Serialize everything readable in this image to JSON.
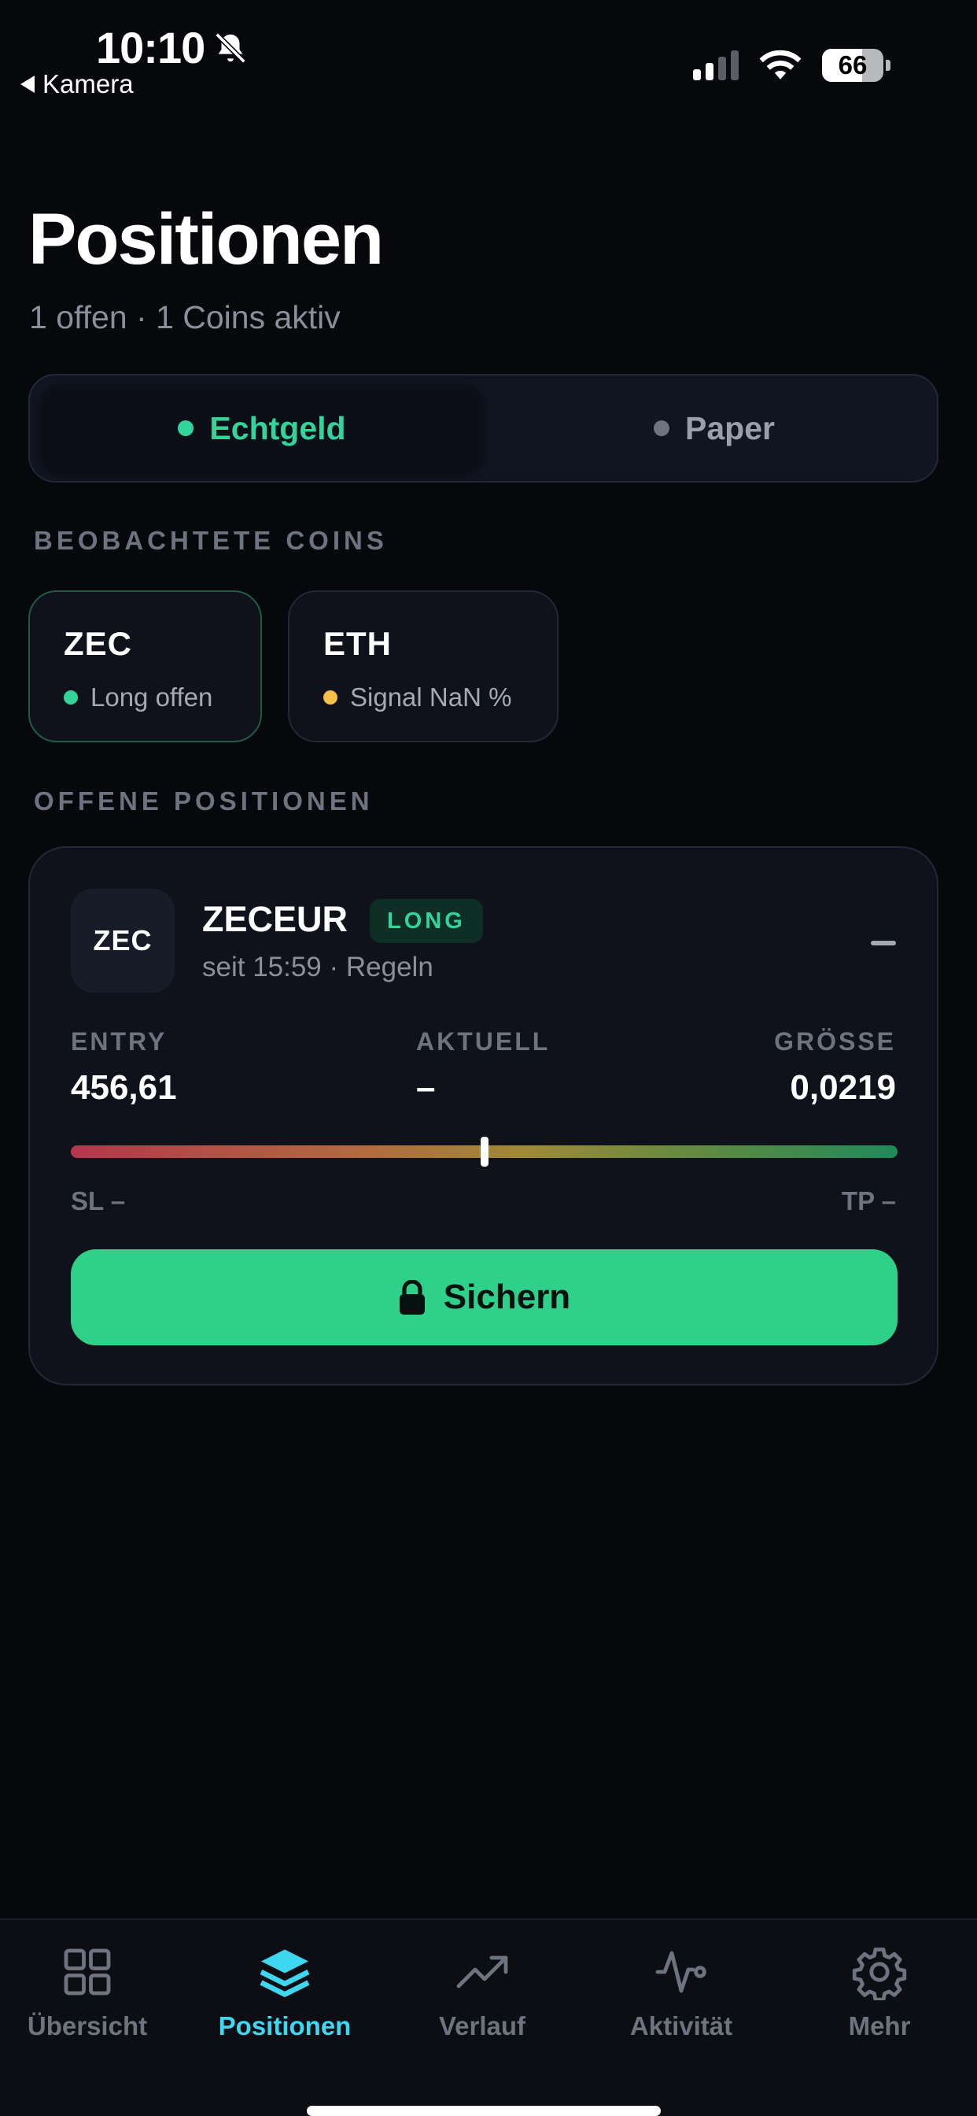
{
  "status_bar": {
    "time": "10:10",
    "back_label": "Kamera",
    "battery": "66"
  },
  "header": {
    "title": "Positionen",
    "subtitle": "1 offen · 1 Coins aktiv"
  },
  "mode_toggle": {
    "options": [
      {
        "label": "Echtgeld",
        "active": true,
        "dot_color": "#34d399"
      },
      {
        "label": "Paper",
        "active": false,
        "dot_color": "#6e7380"
      }
    ]
  },
  "watched_coins": {
    "section_label": "BEOBACHTETE COINS",
    "coins": [
      {
        "symbol": "ZEC",
        "status": "Long offen",
        "dot_color": "#34d399",
        "active": true
      },
      {
        "symbol": "ETH",
        "status": "Signal NaN %",
        "dot_color": "#f5c04a",
        "active": false
      }
    ]
  },
  "open_positions": {
    "section_label": "OFFENE POSITIONEN",
    "positions": [
      {
        "avatar": "ZEC",
        "symbol": "ZECEUR",
        "badge": "LONG",
        "meta": "seit 15:59 · Regeln",
        "stats": {
          "entry_label": "ENTRY",
          "entry_value": "456,61",
          "current_label": "AKTUELL",
          "current_value": "–",
          "size_label": "GRÖSSE",
          "size_value": "0,0219"
        },
        "range_position": 0.5,
        "sl_label": "SL –",
        "tp_label": "TP –",
        "action_label": "Sichern"
      }
    ]
  },
  "tab_bar": {
    "tabs": [
      {
        "label": "Übersicht",
        "icon": "grid-icon",
        "active": false
      },
      {
        "label": "Positionen",
        "icon": "layers-icon",
        "active": true
      },
      {
        "label": "Verlauf",
        "icon": "trend-up-icon",
        "active": false
      },
      {
        "label": "Aktivität",
        "icon": "activity-icon",
        "active": false
      },
      {
        "label": "Mehr",
        "icon": "gear-icon",
        "active": false
      }
    ]
  },
  "colors": {
    "accent_green": "#34d399",
    "accent_cyan": "#3fd6ef",
    "background": "#07080c"
  }
}
